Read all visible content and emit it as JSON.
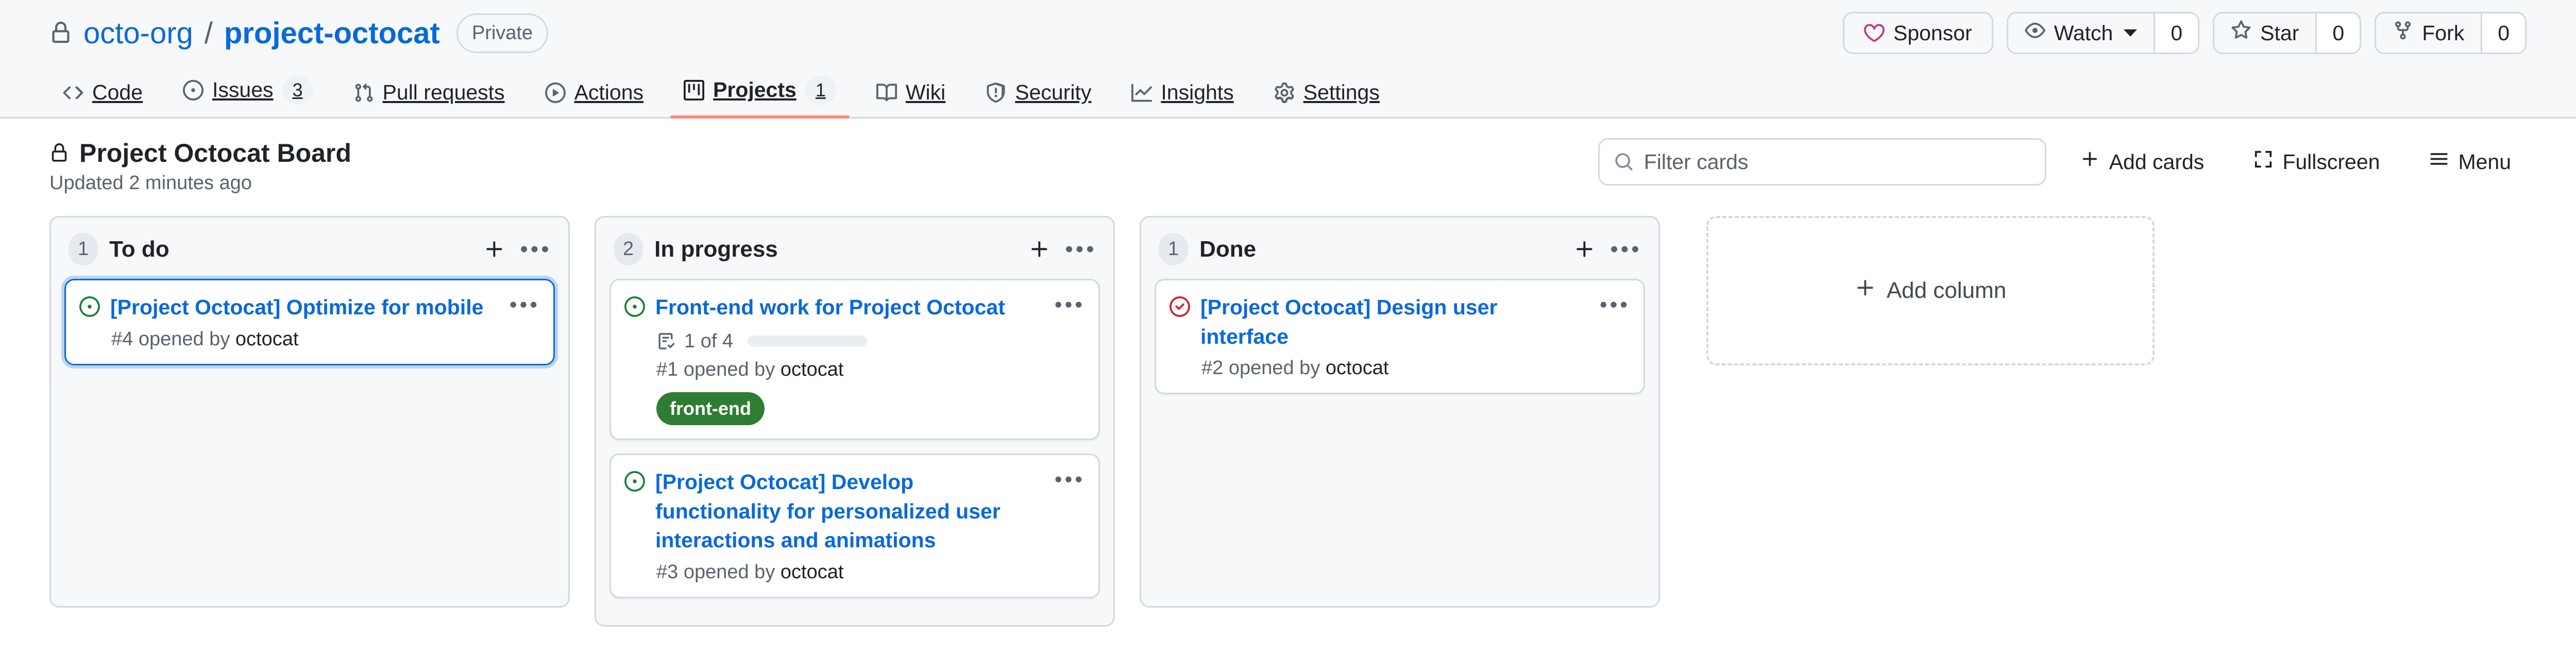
{
  "repo": {
    "owner": "octo-org",
    "separator": "/",
    "name": "project-octocat",
    "visibility": "Private"
  },
  "repo_actions": {
    "sponsor": "Sponsor",
    "watch": "Watch",
    "watch_count": "0",
    "star": "Star",
    "star_count": "0",
    "fork": "Fork",
    "fork_count": "0"
  },
  "nav_tabs": [
    {
      "label": "Code",
      "icon": "code-icon",
      "count": null,
      "active": false
    },
    {
      "label": "Issues",
      "icon": "issue-opened-icon",
      "count": "3",
      "active": false
    },
    {
      "label": "Pull requests",
      "icon": "git-pull-request-icon",
      "count": null,
      "active": false
    },
    {
      "label": "Actions",
      "icon": "play-icon",
      "count": null,
      "active": false
    },
    {
      "label": "Projects",
      "icon": "project-icon",
      "count": "1",
      "active": true
    },
    {
      "label": "Wiki",
      "icon": "book-icon",
      "count": null,
      "active": false
    },
    {
      "label": "Security",
      "icon": "shield-icon",
      "count": null,
      "active": false
    },
    {
      "label": "Insights",
      "icon": "graph-icon",
      "count": null,
      "active": false
    },
    {
      "label": "Settings",
      "icon": "gear-icon",
      "count": null,
      "active": false
    }
  ],
  "project": {
    "title": "Project Octocat Board",
    "updated": "Updated 2 minutes ago",
    "lock_icon": "lock-icon"
  },
  "toolbar": {
    "filter_placeholder": "Filter cards",
    "filter_value": "",
    "add_cards": "Add cards",
    "fullscreen": "Fullscreen",
    "menu": "Menu"
  },
  "board": {
    "add_column_label": "Add column",
    "columns": [
      {
        "name": "To do",
        "count": "1",
        "cards": [
          {
            "title": "[Project Octocat] Optimize for mobile",
            "meta_prefix": "#4 opened by",
            "author": "octocat",
            "state": "open",
            "state_icon": "issue-opened-icon",
            "focused": true,
            "tasks": null,
            "labels": []
          }
        ]
      },
      {
        "name": "In progress",
        "count": "2",
        "cards": [
          {
            "title": "Front-end work for Project Octocat",
            "meta_prefix": "#1 opened by",
            "author": "octocat",
            "state": "open",
            "state_icon": "issue-opened-icon",
            "focused": false,
            "tasks": {
              "text": "1 of 4",
              "completed": 1,
              "total": 4,
              "percent": 25
            },
            "labels": [
              {
                "name": "front-end",
                "color": "#2f7d32"
              }
            ]
          },
          {
            "title": "[Project Octocat] Develop functionality for personalized user interactions and animations",
            "meta_prefix": "#3 opened by",
            "author": "octocat",
            "state": "open",
            "state_icon": "issue-opened-icon",
            "focused": false,
            "tasks": null,
            "labels": []
          }
        ]
      },
      {
        "name": "Done",
        "count": "1",
        "cards": [
          {
            "title": "[Project Octocat] Design user interface",
            "meta_prefix": "#2 opened by",
            "author": "octocat",
            "state": "closed",
            "state_icon": "issue-closed-icon",
            "focused": false,
            "tasks": null,
            "labels": []
          }
        ]
      }
    ]
  },
  "colors": {
    "link": "#0969da",
    "open_green": "#1a7f37",
    "closed_red": "#cf222e",
    "sponsor_pink": "#bf3989",
    "active_tab_underline": "#fd8c73"
  }
}
